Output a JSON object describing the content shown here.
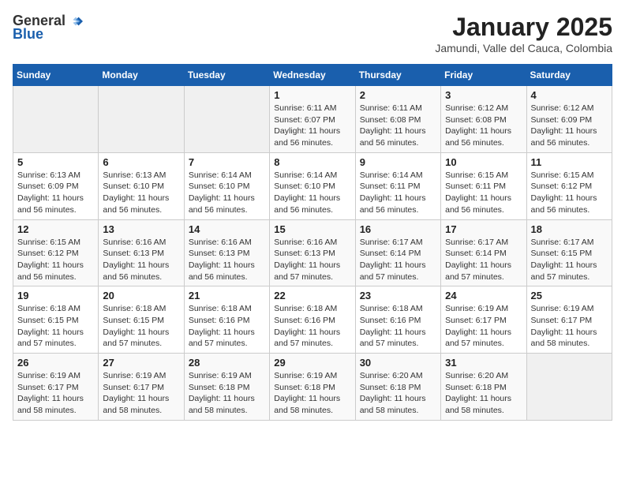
{
  "logo": {
    "general": "General",
    "blue": "Blue"
  },
  "header": {
    "month": "January 2025",
    "location": "Jamundi, Valle del Cauca, Colombia"
  },
  "weekdays": [
    "Sunday",
    "Monday",
    "Tuesday",
    "Wednesday",
    "Thursday",
    "Friday",
    "Saturday"
  ],
  "weeks": [
    [
      {
        "day": "",
        "info": ""
      },
      {
        "day": "",
        "info": ""
      },
      {
        "day": "",
        "info": ""
      },
      {
        "day": "1",
        "info": "Sunrise: 6:11 AM\nSunset: 6:07 PM\nDaylight: 11 hours and 56 minutes."
      },
      {
        "day": "2",
        "info": "Sunrise: 6:11 AM\nSunset: 6:08 PM\nDaylight: 11 hours and 56 minutes."
      },
      {
        "day": "3",
        "info": "Sunrise: 6:12 AM\nSunset: 6:08 PM\nDaylight: 11 hours and 56 minutes."
      },
      {
        "day": "4",
        "info": "Sunrise: 6:12 AM\nSunset: 6:09 PM\nDaylight: 11 hours and 56 minutes."
      }
    ],
    [
      {
        "day": "5",
        "info": "Sunrise: 6:13 AM\nSunset: 6:09 PM\nDaylight: 11 hours and 56 minutes."
      },
      {
        "day": "6",
        "info": "Sunrise: 6:13 AM\nSunset: 6:10 PM\nDaylight: 11 hours and 56 minutes."
      },
      {
        "day": "7",
        "info": "Sunrise: 6:14 AM\nSunset: 6:10 PM\nDaylight: 11 hours and 56 minutes."
      },
      {
        "day": "8",
        "info": "Sunrise: 6:14 AM\nSunset: 6:10 PM\nDaylight: 11 hours and 56 minutes."
      },
      {
        "day": "9",
        "info": "Sunrise: 6:14 AM\nSunset: 6:11 PM\nDaylight: 11 hours and 56 minutes."
      },
      {
        "day": "10",
        "info": "Sunrise: 6:15 AM\nSunset: 6:11 PM\nDaylight: 11 hours and 56 minutes."
      },
      {
        "day": "11",
        "info": "Sunrise: 6:15 AM\nSunset: 6:12 PM\nDaylight: 11 hours and 56 minutes."
      }
    ],
    [
      {
        "day": "12",
        "info": "Sunrise: 6:15 AM\nSunset: 6:12 PM\nDaylight: 11 hours and 56 minutes."
      },
      {
        "day": "13",
        "info": "Sunrise: 6:16 AM\nSunset: 6:13 PM\nDaylight: 11 hours and 56 minutes."
      },
      {
        "day": "14",
        "info": "Sunrise: 6:16 AM\nSunset: 6:13 PM\nDaylight: 11 hours and 56 minutes."
      },
      {
        "day": "15",
        "info": "Sunrise: 6:16 AM\nSunset: 6:13 PM\nDaylight: 11 hours and 57 minutes."
      },
      {
        "day": "16",
        "info": "Sunrise: 6:17 AM\nSunset: 6:14 PM\nDaylight: 11 hours and 57 minutes."
      },
      {
        "day": "17",
        "info": "Sunrise: 6:17 AM\nSunset: 6:14 PM\nDaylight: 11 hours and 57 minutes."
      },
      {
        "day": "18",
        "info": "Sunrise: 6:17 AM\nSunset: 6:15 PM\nDaylight: 11 hours and 57 minutes."
      }
    ],
    [
      {
        "day": "19",
        "info": "Sunrise: 6:18 AM\nSunset: 6:15 PM\nDaylight: 11 hours and 57 minutes."
      },
      {
        "day": "20",
        "info": "Sunrise: 6:18 AM\nSunset: 6:15 PM\nDaylight: 11 hours and 57 minutes."
      },
      {
        "day": "21",
        "info": "Sunrise: 6:18 AM\nSunset: 6:16 PM\nDaylight: 11 hours and 57 minutes."
      },
      {
        "day": "22",
        "info": "Sunrise: 6:18 AM\nSunset: 6:16 PM\nDaylight: 11 hours and 57 minutes."
      },
      {
        "day": "23",
        "info": "Sunrise: 6:18 AM\nSunset: 6:16 PM\nDaylight: 11 hours and 57 minutes."
      },
      {
        "day": "24",
        "info": "Sunrise: 6:19 AM\nSunset: 6:17 PM\nDaylight: 11 hours and 57 minutes."
      },
      {
        "day": "25",
        "info": "Sunrise: 6:19 AM\nSunset: 6:17 PM\nDaylight: 11 hours and 58 minutes."
      }
    ],
    [
      {
        "day": "26",
        "info": "Sunrise: 6:19 AM\nSunset: 6:17 PM\nDaylight: 11 hours and 58 minutes."
      },
      {
        "day": "27",
        "info": "Sunrise: 6:19 AM\nSunset: 6:17 PM\nDaylight: 11 hours and 58 minutes."
      },
      {
        "day": "28",
        "info": "Sunrise: 6:19 AM\nSunset: 6:18 PM\nDaylight: 11 hours and 58 minutes."
      },
      {
        "day": "29",
        "info": "Sunrise: 6:19 AM\nSunset: 6:18 PM\nDaylight: 11 hours and 58 minutes."
      },
      {
        "day": "30",
        "info": "Sunrise: 6:20 AM\nSunset: 6:18 PM\nDaylight: 11 hours and 58 minutes."
      },
      {
        "day": "31",
        "info": "Sunrise: 6:20 AM\nSunset: 6:18 PM\nDaylight: 11 hours and 58 minutes."
      },
      {
        "day": "",
        "info": ""
      }
    ]
  ]
}
